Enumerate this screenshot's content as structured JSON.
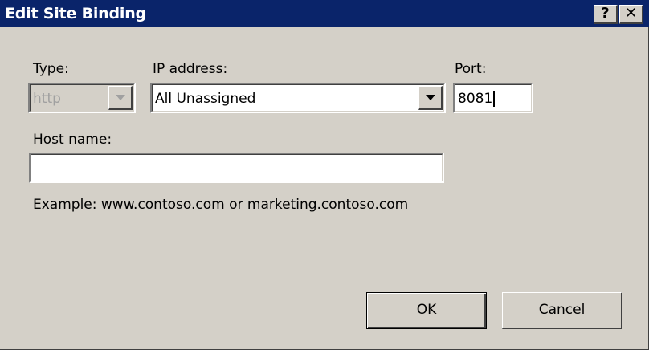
{
  "window": {
    "title": "Edit Site Binding",
    "help_label": "?",
    "close_label": "✕"
  },
  "fields": {
    "type": {
      "label": "Type:",
      "value": "http",
      "disabled": true
    },
    "ip_address": {
      "label": "IP address:",
      "value": "All Unassigned"
    },
    "port": {
      "label": "Port:",
      "value": "8081"
    },
    "host_name": {
      "label": "Host name:",
      "value": ""
    }
  },
  "example_text": "Example: www.contoso.com or marketing.contoso.com",
  "buttons": {
    "ok_label": "OK",
    "cancel_label": "Cancel"
  },
  "icons": {
    "help": "help-icon",
    "close": "close-icon",
    "dropdown": "chevron-down-icon"
  },
  "colors": {
    "titlebar": "#0a246a",
    "dialog_bg": "#d4d0c8",
    "disabled_text": "#a0a0a0"
  }
}
